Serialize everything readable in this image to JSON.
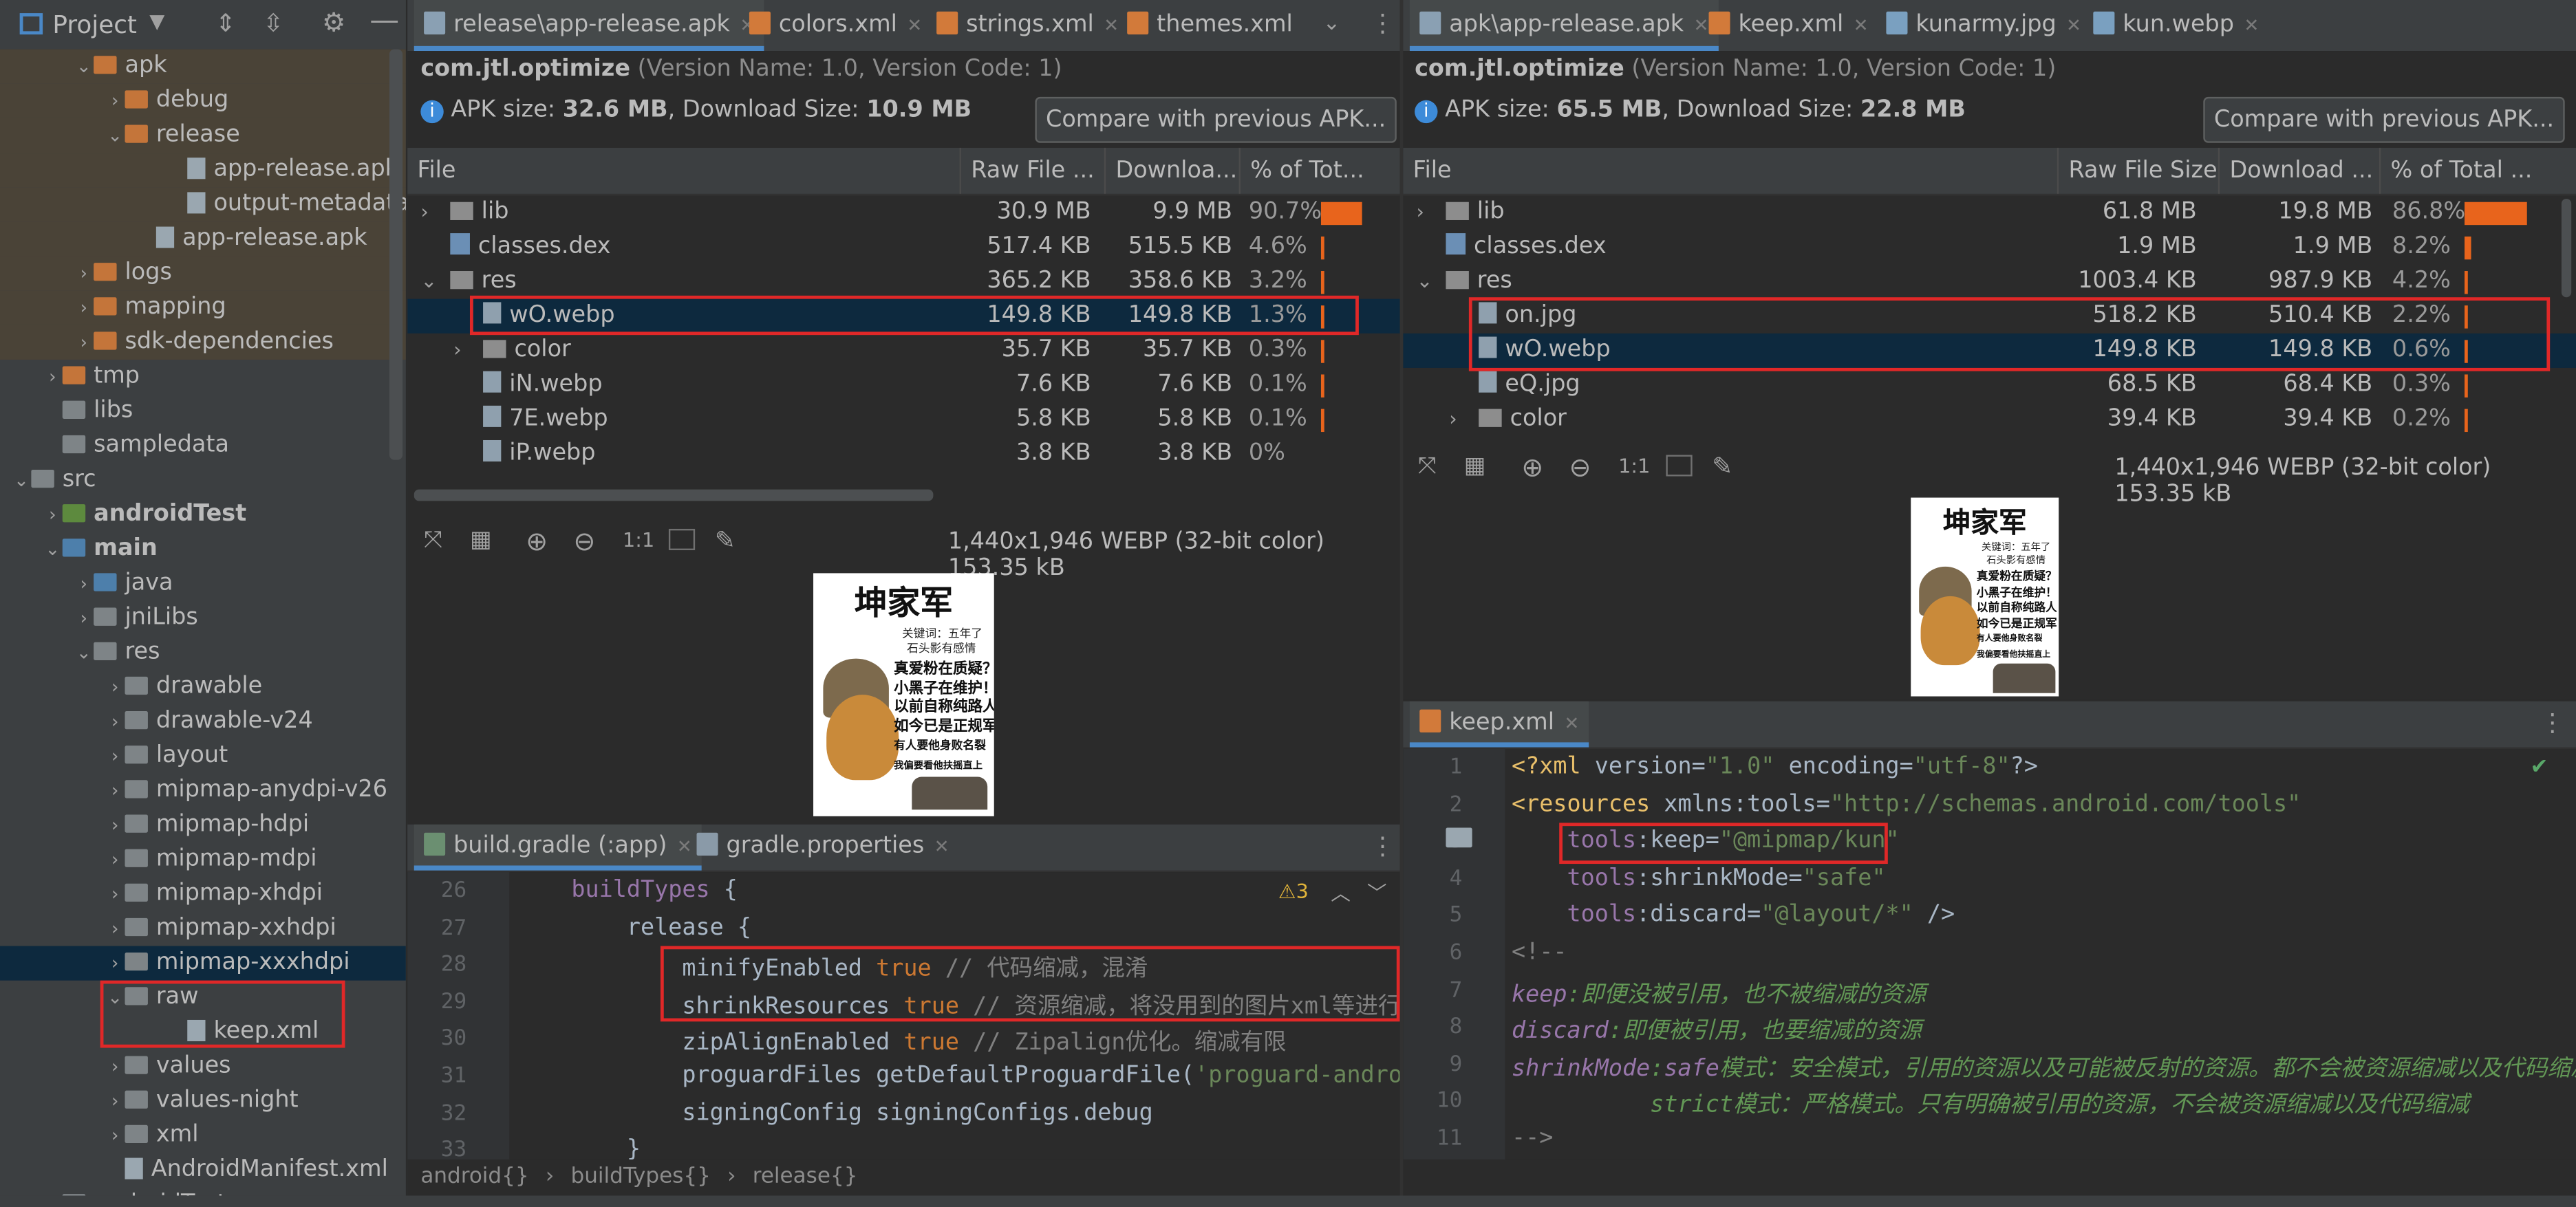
{
  "project": {
    "title": "Project",
    "tree": [
      {
        "label": "apk",
        "indent": 3,
        "expanded": true,
        "folder": "orange"
      },
      {
        "label": "debug",
        "indent": 4,
        "expanded": false,
        "folder": "orange"
      },
      {
        "label": "release",
        "indent": 4,
        "expanded": true,
        "folder": "orange"
      },
      {
        "label": "app-release.apk",
        "indent": 6,
        "file": true
      },
      {
        "label": "output-metadata.json",
        "indent": 6,
        "file": true
      },
      {
        "label": "app-release.apk",
        "indent": 5,
        "file": true
      },
      {
        "label": "logs",
        "indent": 3,
        "expanded": false,
        "folder": "orange"
      },
      {
        "label": "mapping",
        "indent": 3,
        "expanded": false,
        "folder": "orange"
      },
      {
        "label": "sdk-dependencies",
        "indent": 3,
        "expanded": false,
        "folder": "orange"
      },
      {
        "label": "tmp",
        "indent": 2,
        "expanded": false,
        "folder": "orange"
      },
      {
        "label": "libs",
        "indent": 2,
        "folder": "gray"
      },
      {
        "label": "sampledata",
        "indent": 2,
        "folder": "gray"
      },
      {
        "label": "src",
        "indent": 1,
        "expanded": true,
        "folder": "gray"
      },
      {
        "label": "androidTest",
        "indent": 2,
        "expanded": false,
        "folder": "green",
        "bold": true
      },
      {
        "label": "main",
        "indent": 2,
        "expanded": true,
        "folder": "blue",
        "bold": true
      },
      {
        "label": "java",
        "indent": 3,
        "expanded": false,
        "folder": "blue"
      },
      {
        "label": "jniLibs",
        "indent": 3,
        "expanded": false,
        "folder": "gray"
      },
      {
        "label": "res",
        "indent": 3,
        "expanded": true,
        "folder": "gray"
      },
      {
        "label": "drawable",
        "indent": 4,
        "expanded": false,
        "folder": "gray"
      },
      {
        "label": "drawable-v24",
        "indent": 4,
        "expanded": false,
        "folder": "gray"
      },
      {
        "label": "layout",
        "indent": 4,
        "expanded": false,
        "folder": "gray"
      },
      {
        "label": "mipmap-anydpi-v26",
        "indent": 4,
        "expanded": false,
        "folder": "gray"
      },
      {
        "label": "mipmap-hdpi",
        "indent": 4,
        "expanded": false,
        "folder": "gray"
      },
      {
        "label": "mipmap-mdpi",
        "indent": 4,
        "expanded": false,
        "folder": "gray"
      },
      {
        "label": "mipmap-xhdpi",
        "indent": 4,
        "expanded": false,
        "folder": "gray"
      },
      {
        "label": "mipmap-xxhdpi",
        "indent": 4,
        "expanded": false,
        "folder": "gray"
      },
      {
        "label": "mipmap-xxxhdpi",
        "indent": 4,
        "expanded": false,
        "folder": "gray",
        "selected": true
      },
      {
        "label": "raw",
        "indent": 4,
        "expanded": true,
        "folder": "gray"
      },
      {
        "label": "keep.xml",
        "indent": 6,
        "file": true
      },
      {
        "label": "values",
        "indent": 4,
        "expanded": false,
        "folder": "gray"
      },
      {
        "label": "values-night",
        "indent": 4,
        "expanded": false,
        "folder": "gray"
      },
      {
        "label": "xml",
        "indent": 4,
        "expanded": false,
        "folder": "gray"
      },
      {
        "label": "AndroidManifest.xml",
        "indent": 4,
        "file": true
      },
      {
        "label": "androidTest",
        "indent": 2,
        "folder": "gray"
      }
    ]
  },
  "left_tabs": [
    "release\\app-release.apk",
    "colors.xml",
    "strings.xml",
    "themes.xml"
  ],
  "right_tabs": [
    "apk\\app-release.apk",
    "keep.xml",
    "kunarmy.jpg",
    "kun.webp"
  ],
  "left_apk": {
    "package": "com.jtl.optimize",
    "version": "(Version Name: 1.0, Version Code: 1)",
    "size_label": "APK size: ",
    "size": "32.6 MB",
    "dl_label": ", Download Size: ",
    "dl": "10.9 MB",
    "compare": "Compare with previous APK...",
    "columns": [
      "File",
      "Raw File ...",
      "Downloa...",
      "% of Tot..."
    ],
    "rows": [
      {
        "name": "lib",
        "raw": "30.9 MB",
        "dl": "9.9 MB",
        "pct": "90.7%",
        "fill": 0.907,
        "kind": "folder",
        "indent": 0,
        "chev": ">"
      },
      {
        "name": "classes.dex",
        "raw": "517.4 KB",
        "dl": "515.5 KB",
        "pct": "4.6%",
        "fill": 0.046,
        "kind": "dex",
        "indent": 0
      },
      {
        "name": "res",
        "raw": "365.2 KB",
        "dl": "358.6 KB",
        "pct": "3.2%",
        "fill": 0.032,
        "kind": "folder",
        "indent": 0,
        "chev": "v"
      },
      {
        "name": "wO.webp",
        "raw": "149.8 KB",
        "dl": "149.8 KB",
        "pct": "1.3%",
        "fill": 0.013,
        "kind": "file",
        "indent": 1,
        "selected": true
      },
      {
        "name": "color",
        "raw": "35.7 KB",
        "dl": "35.7 KB",
        "pct": "0.3%",
        "fill": 0.003,
        "kind": "folder",
        "indent": 1,
        "chev": ">"
      },
      {
        "name": "iN.webp",
        "raw": "7.6 KB",
        "dl": "7.6 KB",
        "pct": "0.1%",
        "fill": 0.001,
        "kind": "file",
        "indent": 1
      },
      {
        "name": "7E.webp",
        "raw": "5.8 KB",
        "dl": "5.8 KB",
        "pct": "0.1%",
        "fill": 0.001,
        "kind": "file",
        "indent": 1
      },
      {
        "name": "iP.webp",
        "raw": "3.8 KB",
        "dl": "3.8 KB",
        "pct": "0%",
        "fill": 0,
        "kind": "file",
        "indent": 1
      }
    ],
    "image_info": "1,440x1,946 WEBP (32-bit color) 153.35 kB",
    "zoom_one": "1:1"
  },
  "right_apk": {
    "package": "com.jtl.optimize",
    "version": "(Version Name: 1.0, Version Code: 1)",
    "size_label": "APK size: ",
    "size": "65.5 MB",
    "dl_label": ", Download Size: ",
    "dl": "22.8 MB",
    "compare": "Compare with previous APK...",
    "columns": [
      "File",
      "Raw File Size",
      "Download ...",
      "% of Total ..."
    ],
    "rows": [
      {
        "name": "lib",
        "raw": "61.8 MB",
        "dl": "19.8 MB",
        "pct": "86.8%",
        "fill": 0.868,
        "kind": "folder",
        "indent": 0,
        "chev": ">"
      },
      {
        "name": "classes.dex",
        "raw": "1.9 MB",
        "dl": "1.9 MB",
        "pct": "8.2%",
        "fill": 0.082,
        "kind": "dex",
        "indent": 0
      },
      {
        "name": "res",
        "raw": "1003.4 KB",
        "dl": "987.9 KB",
        "pct": "4.2%",
        "fill": 0.042,
        "kind": "folder",
        "indent": 0,
        "chev": "v"
      },
      {
        "name": "on.jpg",
        "raw": "518.2 KB",
        "dl": "510.4 KB",
        "pct": "2.2%",
        "fill": 0.022,
        "kind": "file",
        "indent": 1
      },
      {
        "name": "wO.webp",
        "raw": "149.8 KB",
        "dl": "149.8 KB",
        "pct": "0.6%",
        "fill": 0.006,
        "kind": "file",
        "indent": 1,
        "selected": true
      },
      {
        "name": "eQ.jpg",
        "raw": "68.5 KB",
        "dl": "68.4 KB",
        "pct": "0.3%",
        "fill": 0.003,
        "kind": "file",
        "indent": 1
      },
      {
        "name": "color",
        "raw": "39.4 KB",
        "dl": "39.4 KB",
        "pct": "0.2%",
        "fill": 0.002,
        "kind": "folder",
        "indent": 1,
        "chev": ">"
      }
    ],
    "image_info": "1,440x1,946 WEBP (32-bit color) 153.35 kB",
    "zoom_one": "1:1"
  },
  "poster": {
    "title": "坤家军",
    "sub1": "关键词：五年了",
    "sub2": "石头影有感情",
    "lines": [
      "真爱粉在质疑？",
      "小黑子在维护！",
      "以前自称纯路人",
      "如今已是正规军",
      "有人要他身败名裂",
      "我偏要看他扶摇直上"
    ]
  },
  "gradle": {
    "tabs": [
      "build.gradle (:app)",
      "gradle.properties"
    ],
    "warn": "3",
    "lines": [
      {
        "n": "26",
        "code": "    buildTypes {"
      },
      {
        "n": "27",
        "code": "        release {"
      },
      {
        "n": "28",
        "code": "            minifyEnabled true // 代码缩减，混淆"
      },
      {
        "n": "29",
        "code": "            shrinkResources true // 资源缩减，将没用到的图片xml等进行优化"
      },
      {
        "n": "30",
        "code": "            zipAlignEnabled true // Zipalign优化。缩减有限"
      },
      {
        "n": "31",
        "code": "            proguardFiles getDefaultProguardFile('proguard-android-optimize.txt')"
      },
      {
        "n": "32",
        "code": "            signingConfig signingConfigs.debug"
      },
      {
        "n": "33",
        "code": "        }"
      }
    ],
    "breadcrumb": [
      "android{}",
      "buildTypes{}",
      "release{}"
    ]
  },
  "keepxml": {
    "tab": "keep.xml",
    "lines": [
      {
        "n": "1",
        "code": "<?xml version=\"1.0\" encoding=\"utf-8\"?>"
      },
      {
        "n": "2",
        "code": "<resources xmlns:tools=\"http://schemas.android.com/tools\""
      },
      {
        "n": "3",
        "code": "    tools:keep=\"@mipmap/kun\""
      },
      {
        "n": "4",
        "code": "    tools:shrinkMode=\"safe\""
      },
      {
        "n": "5",
        "code": "    tools:discard=\"@layout/*\" />"
      },
      {
        "n": "6",
        "code": "<!--"
      },
      {
        "n": "7",
        "code": "keep:即便没被引用，也不被缩减的资源"
      },
      {
        "n": "8",
        "code": "discard:即便被引用，也要缩减的资源"
      },
      {
        "n": "9",
        "code": "shrinkMode:safe模式：安全模式，引用的资源以及可能被反射的资源。都不会被资源缩减以及代码缩减"
      },
      {
        "n": "10",
        "code": "          strict模式：严格模式。只有明确被引用的资源，不会被资源缩减以及代码缩减"
      },
      {
        "n": "11",
        "code": "-->"
      }
    ]
  },
  "colors": {
    "accent": "#4a88c7",
    "bar": "#e8641c",
    "redbox": "#e02828",
    "bg": "#2b2b2b",
    "panel": "#3c3f41"
  }
}
